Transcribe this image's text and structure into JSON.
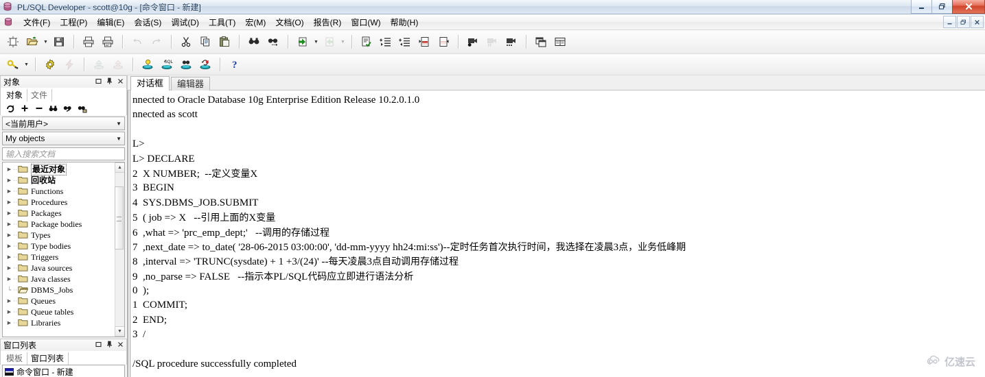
{
  "window": {
    "title": "PL/SQL Developer - scott@10g - [命令窗口 - 新建]",
    "minimize": "—",
    "restore": "❐",
    "close": "✕"
  },
  "mdi_buttons": {
    "minimize": "_",
    "restore": "❐",
    "close": "✕"
  },
  "menu": [
    {
      "label": "文件(F)",
      "name": "menu-file"
    },
    {
      "label": "工程(P)",
      "name": "menu-project"
    },
    {
      "label": "编辑(E)",
      "name": "menu-edit"
    },
    {
      "label": "会话(S)",
      "name": "menu-session"
    },
    {
      "label": "调试(D)",
      "name": "menu-debug"
    },
    {
      "label": "工具(T)",
      "name": "menu-tools"
    },
    {
      "label": "宏(M)",
      "name": "menu-macro"
    },
    {
      "label": "文档(O)",
      "name": "menu-documents"
    },
    {
      "label": "报告(R)",
      "name": "menu-reports"
    },
    {
      "label": "窗口(W)",
      "name": "menu-window"
    },
    {
      "label": "帮助(H)",
      "name": "menu-help"
    }
  ],
  "toolbar_main": [
    "new-icon",
    "open-folder-icon",
    "open-dropdown-arrow",
    "save-icon",
    "sep",
    "print-icon",
    "print-preview-icon",
    "sep",
    "undo-icon",
    "redo-icon",
    "sep",
    "cut-icon",
    "copy-icon",
    "paste-icon",
    "sep",
    "find-icon",
    "find-next-icon",
    "sep",
    "previous-icon",
    "previous-dropdown-arrow",
    "next-icon",
    "next-dropdown-arrow",
    "sep",
    "explain-plan-icon",
    "indent-icon",
    "outdent-icon",
    "comment-icon",
    "uncomment-icon",
    "sep",
    "record-macro-icon",
    "pause-macro-icon",
    "play-macro-icon",
    "sep",
    "window-list-icon",
    "tile-windows-icon"
  ],
  "toolbar_second": [
    "key-icon",
    "key-dropdown-arrow",
    "sep",
    "settings-gear-icon",
    "lightning-icon",
    "sep",
    "import-icon",
    "export-icon",
    "sep",
    "new-sql-window-icon",
    "sql-window-icon",
    "command-window-icon",
    "rollback-icon",
    "sep",
    "help-question-icon"
  ],
  "objects_panel": {
    "title": "对象",
    "dock_buttons": {
      "float": "❐",
      "pin": "📌",
      "close": "✕"
    },
    "tabs": [
      {
        "label": "对象",
        "active": true
      },
      {
        "label": "文件",
        "active": false
      }
    ],
    "mini_toolbar": [
      "refresh-icon",
      "add-icon",
      "remove-icon",
      "find-icon",
      "find-object-icon",
      "browse-filter-icon"
    ],
    "user_select": "<当前用户>",
    "scope_select": "My objects",
    "search_placeholder": "输入搜索文档",
    "tree": [
      {
        "label": "最近对象",
        "cjk": true,
        "selected": true,
        "open": false,
        "expandable": true
      },
      {
        "label": "回收站",
        "cjk": true,
        "selected": false,
        "open": false,
        "expandable": true
      },
      {
        "label": "Functions",
        "cjk": false,
        "selected": false,
        "open": false,
        "expandable": true
      },
      {
        "label": "Procedures",
        "cjk": false,
        "selected": false,
        "open": false,
        "expandable": true
      },
      {
        "label": "Packages",
        "cjk": false,
        "selected": false,
        "open": false,
        "expandable": true
      },
      {
        "label": "Package bodies",
        "cjk": false,
        "selected": false,
        "open": false,
        "expandable": true
      },
      {
        "label": "Types",
        "cjk": false,
        "selected": false,
        "open": false,
        "expandable": true
      },
      {
        "label": "Type bodies",
        "cjk": false,
        "selected": false,
        "open": false,
        "expandable": true
      },
      {
        "label": "Triggers",
        "cjk": false,
        "selected": false,
        "open": false,
        "expandable": true
      },
      {
        "label": "Java sources",
        "cjk": false,
        "selected": false,
        "open": false,
        "expandable": true
      },
      {
        "label": "Java classes",
        "cjk": false,
        "selected": false,
        "open": false,
        "expandable": true
      },
      {
        "label": "DBMS_Jobs",
        "cjk": false,
        "selected": false,
        "open": true,
        "expandable": false
      },
      {
        "label": "Queues",
        "cjk": false,
        "selected": false,
        "open": false,
        "expandable": true
      },
      {
        "label": "Queue tables",
        "cjk": false,
        "selected": false,
        "open": false,
        "expandable": true
      },
      {
        "label": "Libraries",
        "cjk": false,
        "selected": false,
        "open": false,
        "expandable": true
      }
    ],
    "scroll_up": "▲",
    "scroll_down": "▼"
  },
  "window_list_panel": {
    "title": "窗口列表",
    "dock_buttons": {
      "float": "❐",
      "pin": "📌",
      "close": "✕"
    },
    "tabs": [
      {
        "label": "模板",
        "active": false
      },
      {
        "label": "窗口列表",
        "active": true
      }
    ],
    "items": [
      {
        "label": "命令窗口 - 新建",
        "icon": "command-window-icon"
      }
    ]
  },
  "editor": {
    "tabs": [
      {
        "label": "对话框",
        "active": true
      },
      {
        "label": "编辑器",
        "active": false
      }
    ],
    "lines": [
      {
        "text": "nnected to Oracle Database 10g Enterprise Edition Release 10.2.0.1.0",
        "cjk": false
      },
      {
        "text": "nnected as scott",
        "cjk": false
      },
      {
        "text": "",
        "cjk": false
      },
      {
        "text": "L>",
        "cjk": false
      },
      {
        "text": "L> DECLARE",
        "cjk": false
      },
      {
        "text": "2  X NUMBER;  --定义变量X",
        "cjk": true
      },
      {
        "text": "3  BEGIN",
        "cjk": false
      },
      {
        "text": "4  SYS.DBMS_JOB.SUBMIT",
        "cjk": false
      },
      {
        "text": "5  ( job => X   --引用上面的X变量",
        "cjk": true
      },
      {
        "text": "6  ,what => 'prc_emp_dept;'   --调用的存储过程",
        "cjk": true
      },
      {
        "text": "7  ,next_date => to_date( '28-06-2015 03:00:00', 'dd-mm-yyyy hh24:mi:ss')--定时任务首次执行时间，我选择在凌晨3点，业务低峰期",
        "cjk": true
      },
      {
        "text": "8  ,interval => 'TRUNC(sysdate) + 1 +3/(24)' --每天凌晨3点自动调用存储过程",
        "cjk": true
      },
      {
        "text": "9  ,no_parse => FALSE   --指示本PL/SQL代码应立即进行语法分析",
        "cjk": true
      },
      {
        "text": "0  );",
        "cjk": false
      },
      {
        "text": "1  COMMIT;",
        "cjk": false
      },
      {
        "text": "2  END;",
        "cjk": false
      },
      {
        "text": "3  /",
        "cjk": false
      },
      {
        "text": "",
        "cjk": false
      },
      {
        "text": "/SQL procedure successfully completed",
        "cjk": false
      }
    ]
  },
  "watermark": {
    "text": "亿速云",
    "icon": "cloud-icon"
  },
  "colors": {
    "title_accent": "#1b3a5c",
    "close_button": "#cf4329",
    "folder": "#e8d79a",
    "selection_border": "#555555",
    "watermark": "#b9bcc6"
  }
}
